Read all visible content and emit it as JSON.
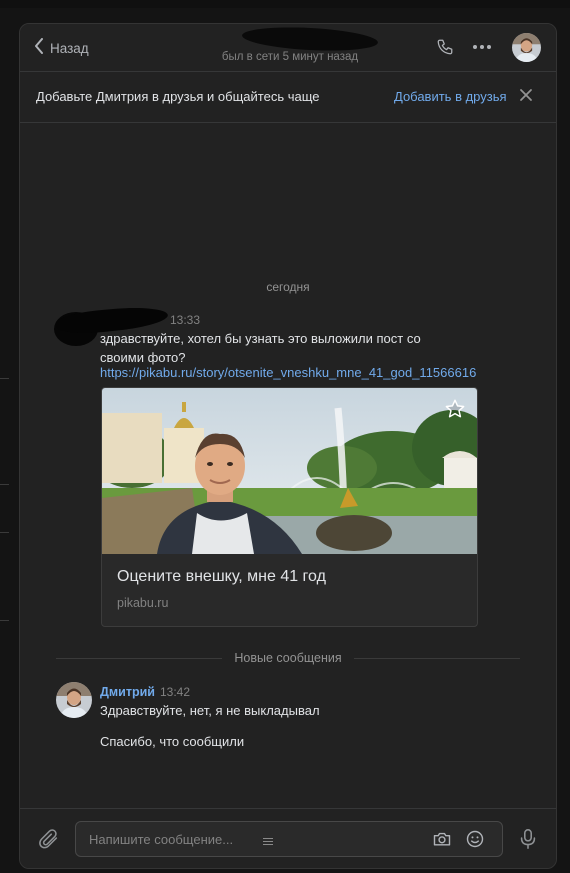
{
  "header": {
    "back_label": "Назад",
    "status": "был в сети 5 минут назад"
  },
  "banner": {
    "text": "Добавьте Дмитрия в друзья и общайтесь чаще",
    "add_label": "Добавить в друзья"
  },
  "chat": {
    "date_separator": "сегодня",
    "messages": [
      {
        "time": "13:33",
        "text": "здравствуйте, хотел бы узнать это выложили пост со своими фото?",
        "link": "https://pikabu.ru/story/otsenite_vneshku_mne_41_god_11566616",
        "card": {
          "title": "Оцените внешку, мне 41 год",
          "domain": "pikabu.ru"
        }
      }
    ],
    "new_messages_label": "Новые сообщения",
    "reply": {
      "sender": "Дмитрий",
      "time": "13:42",
      "lines": [
        "Здравствуйте, нет, я не выкладывал",
        "Спасибо, что сообщили"
      ]
    }
  },
  "composer": {
    "placeholder": "Напишите сообщение..."
  },
  "icons": {
    "back": "chevron-left-icon",
    "call": "phone-icon",
    "more": "more-dots-icon",
    "close": "close-icon",
    "bookmark": "star-icon",
    "attach": "paperclip-icon",
    "camera": "camera-icon",
    "emoji": "smile-icon",
    "voice": "microphone-icon"
  },
  "colors": {
    "accent": "#71aaeb",
    "background": "#222222",
    "text": "#e1e3e6",
    "muted": "#828282"
  }
}
